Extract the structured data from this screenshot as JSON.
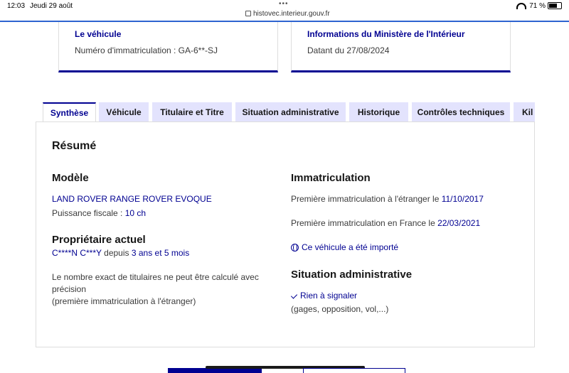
{
  "status_bar": {
    "time": "12:03",
    "date": "Jeudi 29 août",
    "url": "histovec.interieur.gouv.fr",
    "battery": "71 %"
  },
  "cards": {
    "vehicle": {
      "title": "Le véhicule",
      "text": "Numéro d'immatriculation : GA-6**-SJ"
    },
    "ministry": {
      "title": "Informations du Ministère de l'Intérieur",
      "text": "Datant du 27/08/2024"
    }
  },
  "tabs": [
    "Synthèse",
    "Véhicule",
    "Titulaire et Titre",
    "Situation administrative",
    "Historique",
    "Contrôles techniques",
    "Kil"
  ],
  "summary": {
    "title": "Résumé",
    "model": {
      "heading": "Modèle",
      "name": "LAND ROVER RANGE ROVER EVOQUE",
      "power_label": "Puissance fiscale : ",
      "power_value": "10 ch"
    },
    "owner": {
      "heading": "Propriétaire actuel",
      "name": "C****N C***Y",
      "since_label": " depuis ",
      "duration": "3 ans et 5 mois",
      "note_line1": "Le nombre exact de titulaires ne peut être calculé avec",
      "note_line2": "précision",
      "note_line3": "(première immatriculation à l'étranger)"
    },
    "registration": {
      "heading": "Immatriculation",
      "foreign_label": "Première immatriculation à l'étranger le ",
      "foreign_date": "11/10/2017",
      "france_label": "Première immatriculation en France le ",
      "france_date": "22/03/2021",
      "imported": "Ce véhicule a été importé"
    },
    "admin": {
      "heading": "Situation administrative",
      "status": "Rien à signaler",
      "detail": "(gages, opposition, vol,...)"
    }
  },
  "colors": {
    "accent": "#000091",
    "tab_bg": "#e3e3fd",
    "border": "#dddddd"
  }
}
